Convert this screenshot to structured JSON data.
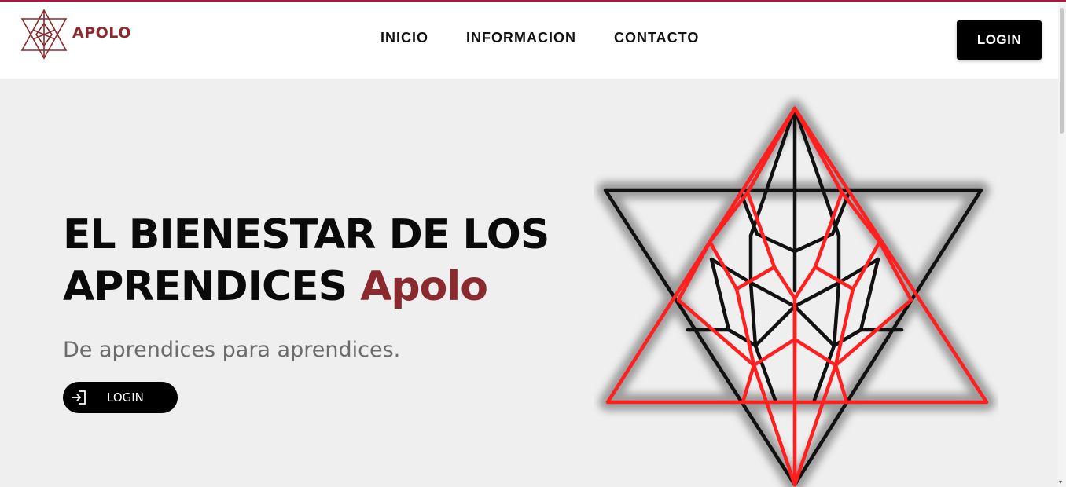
{
  "brand": {
    "name": "APOLO",
    "logo_icon": "star-tetrahedron-logo",
    "color": "#8b2a2e"
  },
  "nav": {
    "items": [
      "INICIO",
      "INFORMACION",
      "CONTACTO"
    ]
  },
  "header": {
    "login_label": "LOGIN"
  },
  "hero": {
    "title_part1": "EL BIENESTAR DE LOS APRENDICES ",
    "title_accent": "Apolo",
    "subtitle": "De aprendices para aprendices.",
    "button_label": "LOGIN",
    "button_icon": "login-icon",
    "art_icon": "star-of-david-geometric-art"
  },
  "colors": {
    "accent": "#8b2a2e",
    "topline": "#b5123f",
    "background": "#efefef",
    "art_red": "#ff1f1f"
  }
}
